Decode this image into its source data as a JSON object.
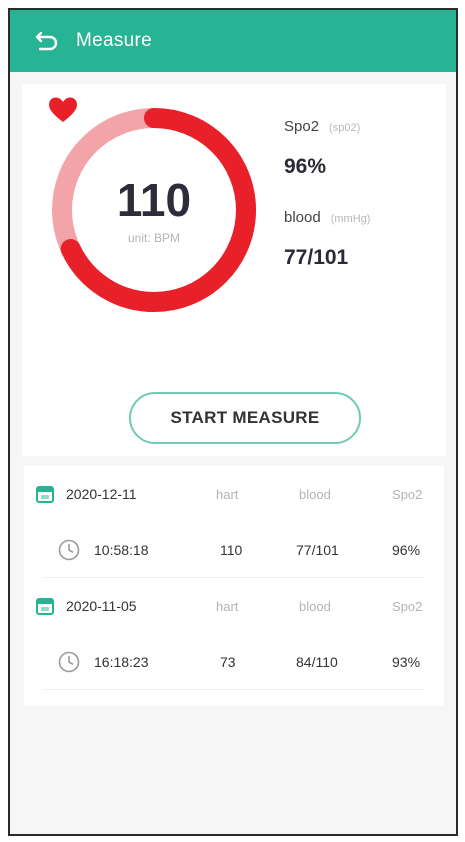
{
  "header": {
    "title": "Measure",
    "back_icon": "back-arrow-icon"
  },
  "heart_rate": {
    "value": "110",
    "unit": "unit: BPM",
    "icon": "heart-icon",
    "progress": 0.68,
    "color": "#e8202a"
  },
  "stats": {
    "spo2": {
      "label": "Spo2",
      "unit": "(sp02)",
      "value": "96%"
    },
    "blood": {
      "label": "blood",
      "unit": "(mmHg)",
      "value": "77/101"
    }
  },
  "start_button": {
    "label": "START MEASURE"
  },
  "records": [
    {
      "date": "2020-12-11",
      "headers": {
        "hr": "hart",
        "blood": "blood",
        "spo2": "Spo2"
      },
      "time": "10:58:18",
      "hr": "110",
      "blood": "77/101",
      "spo2": "96%"
    },
    {
      "date": "2020-11-05",
      "headers": {
        "hr": "hart",
        "blood": "blood",
        "spo2": "Spo2"
      },
      "time": "16:18:23",
      "hr": "73",
      "blood": "84/110",
      "spo2": "93%"
    }
  ],
  "colors": {
    "accent": "#26b495",
    "ring_red": "#e8202a",
    "ring_pink": "#f3a4a8"
  }
}
